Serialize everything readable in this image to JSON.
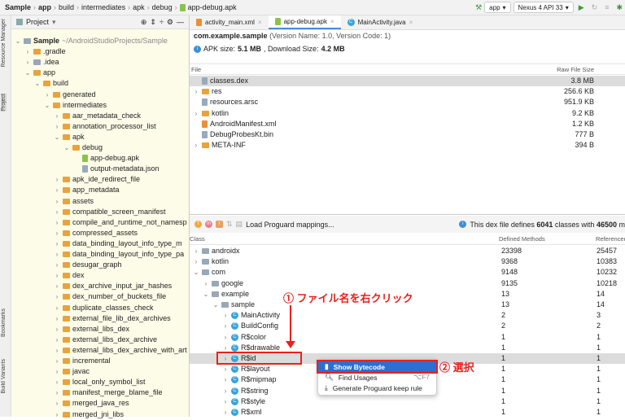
{
  "breadcrumb": [
    "Sample",
    "app",
    "build",
    "intermediates",
    "apk",
    "debug",
    "app-debug.apk"
  ],
  "toolbar": {
    "config": "app",
    "device": "Nexus 4 API 33"
  },
  "side_tabs": {
    "resource_manager": "Resource Manager",
    "project": "Project",
    "bookmarks": "Bookmarks",
    "build_variants": "Build Variants"
  },
  "project": {
    "title": "Project",
    "tree": [
      {
        "d": 0,
        "t": "Sample",
        "x": "~/AndroidStudioProjects/Sample",
        "o": "v",
        "i": "g"
      },
      {
        "d": 1,
        "t": ".gradle",
        "o": ">",
        "i": "f"
      },
      {
        "d": 1,
        "t": ".idea",
        "o": ">",
        "i": "g"
      },
      {
        "d": 1,
        "t": "app",
        "o": "v",
        "i": "f"
      },
      {
        "d": 2,
        "t": "build",
        "o": "v",
        "i": "f"
      },
      {
        "d": 3,
        "t": "generated",
        "o": ">",
        "i": "f"
      },
      {
        "d": 3,
        "t": "intermediates",
        "o": "v",
        "i": "f"
      },
      {
        "d": 4,
        "t": "aar_metadata_check",
        "o": ">",
        "i": "f"
      },
      {
        "d": 4,
        "t": "annotation_processor_list",
        "o": ">",
        "i": "f"
      },
      {
        "d": 4,
        "t": "apk",
        "o": "v",
        "i": "f"
      },
      {
        "d": 5,
        "t": "debug",
        "o": "v",
        "i": "f"
      },
      {
        "d": 6,
        "t": "app-debug.apk",
        "o": "",
        "i": "a"
      },
      {
        "d": 6,
        "t": "output-metadata.json",
        "o": "",
        "i": "j"
      },
      {
        "d": 4,
        "t": "apk_ide_redirect_file",
        "o": ">",
        "i": "f"
      },
      {
        "d": 4,
        "t": "app_metadata",
        "o": ">",
        "i": "f"
      },
      {
        "d": 4,
        "t": "assets",
        "o": ">",
        "i": "f"
      },
      {
        "d": 4,
        "t": "compatible_screen_manifest",
        "o": ">",
        "i": "f"
      },
      {
        "d": 4,
        "t": "compile_and_runtime_not_namesp",
        "o": ">",
        "i": "f"
      },
      {
        "d": 4,
        "t": "compressed_assets",
        "o": ">",
        "i": "f"
      },
      {
        "d": 4,
        "t": "data_binding_layout_info_type_m",
        "o": ">",
        "i": "f"
      },
      {
        "d": 4,
        "t": "data_binding_layout_info_type_pa",
        "o": ">",
        "i": "f"
      },
      {
        "d": 4,
        "t": "desugar_graph",
        "o": ">",
        "i": "f"
      },
      {
        "d": 4,
        "t": "dex",
        "o": ">",
        "i": "f"
      },
      {
        "d": 4,
        "t": "dex_archive_input_jar_hashes",
        "o": ">",
        "i": "f"
      },
      {
        "d": 4,
        "t": "dex_number_of_buckets_file",
        "o": ">",
        "i": "f"
      },
      {
        "d": 4,
        "t": "duplicate_classes_check",
        "o": ">",
        "i": "f"
      },
      {
        "d": 4,
        "t": "external_file_lib_dex_archives",
        "o": ">",
        "i": "f"
      },
      {
        "d": 4,
        "t": "external_libs_dex",
        "o": ">",
        "i": "f"
      },
      {
        "d": 4,
        "t": "external_libs_dex_archive",
        "o": ">",
        "i": "f"
      },
      {
        "d": 4,
        "t": "external_libs_dex_archive_with_art",
        "o": ">",
        "i": "f"
      },
      {
        "d": 4,
        "t": "incremental",
        "o": ">",
        "i": "f"
      },
      {
        "d": 4,
        "t": "javac",
        "o": ">",
        "i": "f"
      },
      {
        "d": 4,
        "t": "local_only_symbol_list",
        "o": ">",
        "i": "f"
      },
      {
        "d": 4,
        "t": "manifest_merge_blame_file",
        "o": ">",
        "i": "f"
      },
      {
        "d": 4,
        "t": "merged_java_res",
        "o": ">",
        "i": "f"
      },
      {
        "d": 4,
        "t": "merged_jni_libs",
        "o": ">",
        "i": "f"
      }
    ]
  },
  "tabs": [
    "activity_main.xml",
    "app-debug.apk",
    "MainActivity.java"
  ],
  "apk": {
    "package": "com.example.sample",
    "version_info": "(Version Name: 1.0, Version Code: 1)",
    "size_label": "APK size:",
    "size": "5.1 MB",
    "download_label": ", Download Size:",
    "download": "4.2 MB"
  },
  "files": {
    "col_file": "File",
    "col_size": "Raw File Size",
    "rows": [
      {
        "o": "",
        "t": "classes.dex",
        "s": "3.8 MB",
        "sel": true,
        "i": "j"
      },
      {
        "o": ">",
        "t": "res",
        "s": "256.6 KB",
        "i": "f"
      },
      {
        "o": "",
        "t": "resources.arsc",
        "s": "951.9 KB",
        "i": "j"
      },
      {
        "o": ">",
        "t": "kotlin",
        "s": "9.2 KB",
        "i": "f"
      },
      {
        "o": "",
        "t": "AndroidManifest.xml",
        "s": "1.2 KB",
        "i": "x"
      },
      {
        "o": "",
        "t": "DebugProbesKt.bin",
        "s": "777 B",
        "i": "j"
      },
      {
        "o": ">",
        "t": "META-INF",
        "s": "394 B",
        "i": "f"
      }
    ]
  },
  "dex": {
    "load_mappings": "Load Proguard mappings...",
    "info_pre": "This dex file defines",
    "classes": "6041",
    "info_mid": "classes with",
    "methods": "46500",
    "info_post": "m",
    "col_class": "Class",
    "col_defined": "Defined Methods",
    "col_ref": "Referenced",
    "rows": [
      {
        "d": 0,
        "o": ">",
        "t": "androidx",
        "a": "23398",
        "b": "25457",
        "i": "p"
      },
      {
        "d": 0,
        "o": ">",
        "t": "kotlin",
        "a": "9368",
        "b": "10383",
        "i": "p"
      },
      {
        "d": 0,
        "o": "v",
        "t": "com",
        "a": "9148",
        "b": "10232",
        "i": "p"
      },
      {
        "d": 1,
        "o": ">",
        "t": "google",
        "a": "9135",
        "b": "10218",
        "i": "p"
      },
      {
        "d": 1,
        "o": "v",
        "t": "example",
        "a": "13",
        "b": "14",
        "i": "p"
      },
      {
        "d": 2,
        "o": "v",
        "t": "sample",
        "a": "13",
        "b": "14",
        "i": "p"
      },
      {
        "d": 3,
        "o": ">",
        "t": "MainActivity",
        "a": "2",
        "b": "3",
        "i": "c"
      },
      {
        "d": 3,
        "o": ">",
        "t": "BuildConfig",
        "a": "2",
        "b": "2",
        "i": "c"
      },
      {
        "d": 3,
        "o": ">",
        "t": "R$color",
        "a": "1",
        "b": "1",
        "i": "c"
      },
      {
        "d": 3,
        "o": ">",
        "t": "R$drawable",
        "a": "1",
        "b": "1",
        "i": "c"
      },
      {
        "d": 3,
        "o": ">",
        "t": "R$id",
        "a": "1",
        "b": "1",
        "i": "c",
        "sel": true
      },
      {
        "d": 3,
        "o": ">",
        "t": "R$layout",
        "a": "1",
        "b": "1",
        "i": "c"
      },
      {
        "d": 3,
        "o": ">",
        "t": "R$mipmap",
        "a": "1",
        "b": "1",
        "i": "c"
      },
      {
        "d": 3,
        "o": ">",
        "t": "R$string",
        "a": "1",
        "b": "1",
        "i": "c"
      },
      {
        "d": 3,
        "o": ">",
        "t": "R$style",
        "a": "1",
        "b": "1",
        "i": "c"
      },
      {
        "d": 3,
        "o": ">",
        "t": "R$xml",
        "a": "1",
        "b": "1",
        "i": "c"
      }
    ]
  },
  "context_menu": [
    {
      "label": "Show Bytecode",
      "shortcut": ""
    },
    {
      "label": "Find Usages",
      "shortcut": "⌥F7"
    },
    {
      "label": "Generate Proguard keep rule",
      "shortcut": ""
    }
  ],
  "annotations": {
    "step1": "① ファイル名を右クリック",
    "step2": "② 選択",
    "color": "#e8211d"
  }
}
